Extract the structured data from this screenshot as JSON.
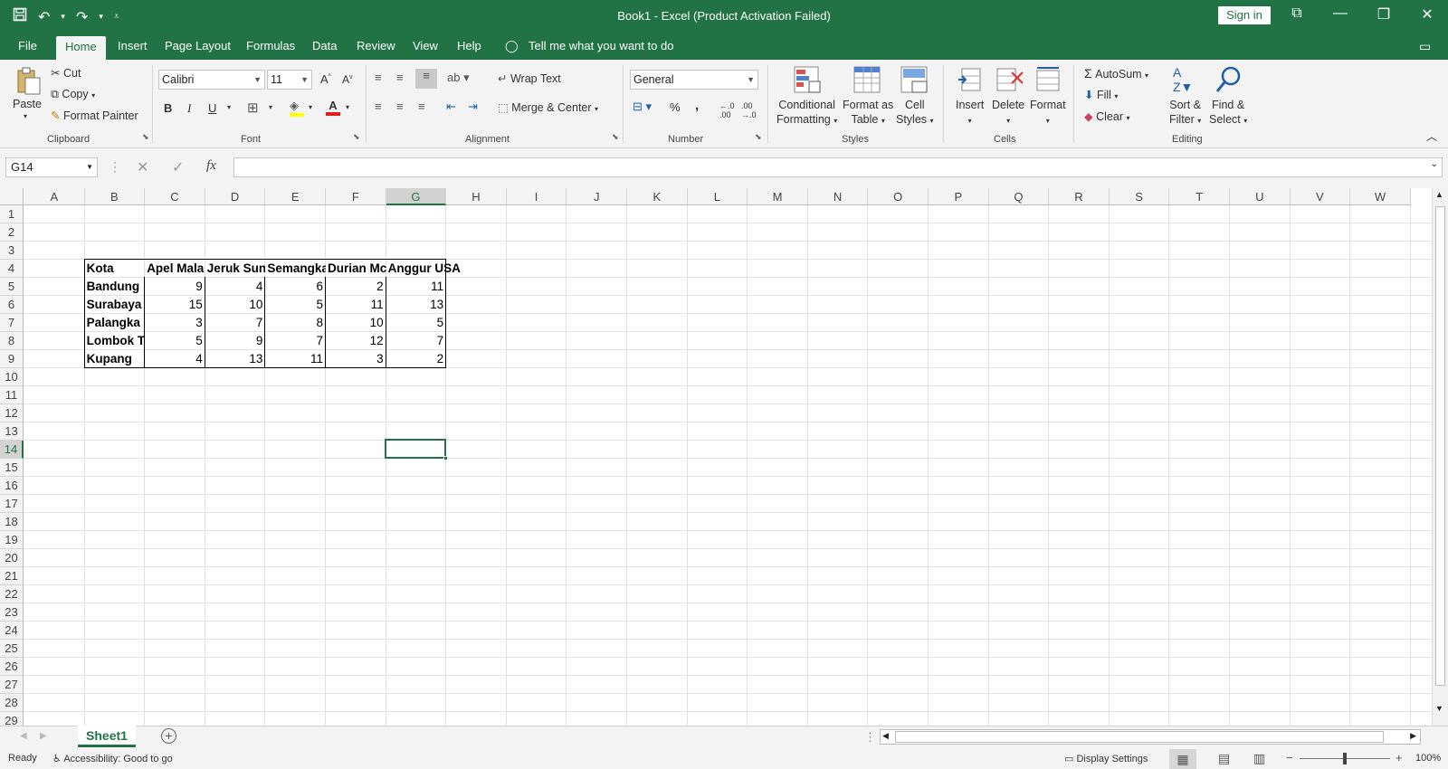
{
  "titlebar": {
    "title": "Book1  -  Excel (Product Activation Failed)",
    "sign_in": "Sign in"
  },
  "menu": {
    "tabs": [
      "File",
      "Home",
      "Insert",
      "Page Layout",
      "Formulas",
      "Data",
      "Review",
      "View",
      "Help"
    ],
    "tell_me": "Tell me what you want to do"
  },
  "ribbon": {
    "clipboard": {
      "paste": "Paste",
      "cut": "Cut",
      "copy": "Copy",
      "format_painter": "Format Painter",
      "label": "Clipboard"
    },
    "font": {
      "name": "Calibri",
      "size": "11",
      "label": "Font",
      "bold": "B",
      "italic": "I",
      "underline": "U"
    },
    "alignment": {
      "wrap_text": "Wrap Text",
      "merge_center": "Merge & Center",
      "label": "Alignment"
    },
    "number": {
      "format": "General",
      "percent": "%",
      "comma": ",",
      "label": "Number"
    },
    "styles": {
      "conditional": "Conditional",
      "formatting": "Formatting",
      "format_as": "Format as",
      "table": "Table",
      "cell": "Cell",
      "styles_text": "Styles",
      "label": "Styles"
    },
    "cells": {
      "insert": "Insert",
      "delete": "Delete",
      "format": "Format",
      "label": "Cells"
    },
    "editing": {
      "autosum": "AutoSum",
      "fill": "Fill",
      "clear": "Clear",
      "sort": "Sort &",
      "filter": "Filter",
      "find": "Find &",
      "select": "Select",
      "label": "Editing"
    }
  },
  "formula_bar": {
    "name_box": "G14",
    "fx": "fx",
    "value": ""
  },
  "grid": {
    "columns": [
      "A",
      "B",
      "C",
      "D",
      "E",
      "F",
      "G",
      "H",
      "I",
      "J",
      "K",
      "L",
      "M",
      "N",
      "O",
      "P",
      "Q",
      "R",
      "S",
      "T",
      "U",
      "V",
      "W"
    ],
    "rows": [
      "1",
      "2",
      "3",
      "4",
      "5",
      "6",
      "7",
      "8",
      "9",
      "10",
      "11",
      "12",
      "13",
      "14",
      "15",
      "16",
      "17",
      "18",
      "19",
      "20",
      "21",
      "22",
      "23",
      "24",
      "25",
      "26",
      "27",
      "28",
      "29"
    ],
    "selected_cell": "G14",
    "table": {
      "headers": [
        "Kota",
        "Apel Mala",
        "Jeruk Sunl",
        "Semangka",
        "Durian Mc",
        "Anggur USA"
      ],
      "rows": [
        [
          "Bandung",
          "9",
          "4",
          "6",
          "2",
          "11"
        ],
        [
          "Surabaya",
          "15",
          "10",
          "5",
          "11",
          "13"
        ],
        [
          "Palangka I",
          "3",
          "7",
          "8",
          "10",
          "5"
        ],
        [
          "Lombok T",
          "5",
          "9",
          "7",
          "12",
          "7"
        ],
        [
          "Kupang",
          "4",
          "13",
          "11",
          "3",
          "2"
        ]
      ]
    }
  },
  "sheets": [
    "Sheet1"
  ],
  "status": {
    "ready": "Ready",
    "accessibility": "Accessibility: Good to go",
    "display_settings": "Display Settings",
    "zoom": "100%"
  }
}
